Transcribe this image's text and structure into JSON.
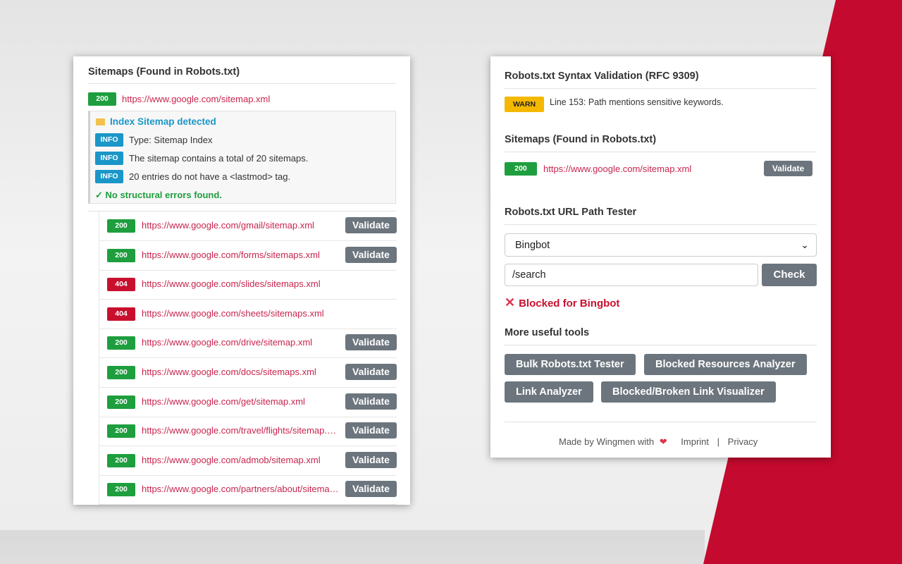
{
  "left": {
    "title": "Sitemaps (Found in Robots.txt)",
    "main": {
      "status": "200",
      "url": "https://www.google.com/sitemap.xml"
    },
    "index": {
      "heading": "Index Sitemap detected",
      "infos": [
        {
          "badge": "INFO",
          "text": "Type: Sitemap Index"
        },
        {
          "badge": "INFO",
          "text": "The sitemap contains a total of 20 sitemaps."
        },
        {
          "badge": "INFO",
          "text": "20 entries do not have a <lastmod> tag."
        }
      ],
      "ok": "✓ No structural errors found."
    },
    "validate_label": "Validate",
    "children": [
      {
        "status": "200",
        "url": "https://www.google.com/gmail/sitemap.xml",
        "validate": "Validate"
      },
      {
        "status": "200",
        "url": "https://www.google.com/forms/sitemaps.xml",
        "validate": "Validate"
      },
      {
        "status": "404",
        "url": "https://www.google.com/slides/sitemaps.xml",
        "validate": ""
      },
      {
        "status": "404",
        "url": "https://www.google.com/sheets/sitemaps.xml",
        "validate": ""
      },
      {
        "status": "200",
        "url": "https://www.google.com/drive/sitemap.xml",
        "validate": "Validate"
      },
      {
        "status": "200",
        "url": "https://www.google.com/docs/sitemaps.xml",
        "validate": "Validate"
      },
      {
        "status": "200",
        "url": "https://www.google.com/get/sitemap.xml",
        "validate": "Validate"
      },
      {
        "status": "200",
        "url": "https://www.google.com/travel/flights/sitemap.xml",
        "validate": "Validate"
      },
      {
        "status": "200",
        "url": "https://www.google.com/admob/sitemap.xml",
        "validate": "Validate"
      },
      {
        "status": "200",
        "url": "https://www.google.com/partners/about/sitemap.xml",
        "validate": "Validate"
      }
    ]
  },
  "right": {
    "syntax_title": "Robots.txt Syntax Validation (RFC 9309)",
    "warn": {
      "badge": "WARN",
      "text": "Line 153: Path mentions sensitive keywords."
    },
    "sitemaps_title": "Sitemaps (Found in Robots.txt)",
    "sitemap": {
      "status": "200",
      "url": "https://www.google.com/sitemap.xml",
      "validate": "Validate"
    },
    "tester_title": "Robots.txt URL Path Tester",
    "agent_selected": "Bingbot",
    "path_value": "/search",
    "check_label": "Check",
    "result": "Blocked for Bingbot",
    "tools_title": "More useful tools",
    "tools": [
      "Bulk Robots.txt Tester",
      "Blocked Resources Analyzer",
      "Link Analyzer",
      "Blocked/Broken Link Visualizer"
    ],
    "footer": {
      "made_by": "Made by Wingmen with",
      "imprint": "Imprint",
      "sep": "|",
      "privacy": "Privacy"
    }
  },
  "colors": {
    "accent_red": "#c40a2e",
    "ok_green": "#1e9e3e",
    "error_red": "#c8102e",
    "info_blue": "#1a96c8",
    "warn_yellow": "#f5b800",
    "button_gray": "#6c757d"
  }
}
